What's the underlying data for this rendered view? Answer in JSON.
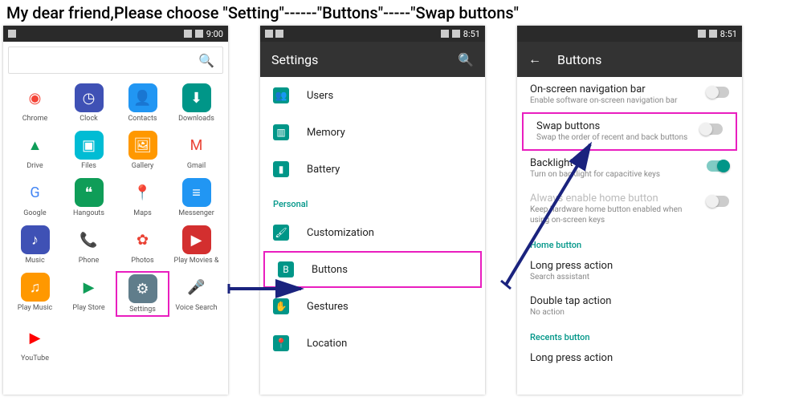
{
  "instruction": "My dear friend,Please choose \"Setting\"------\"Buttons\"-----\"Swap buttons\"",
  "time1": "9:00",
  "time2": "8:51",
  "time3": "8:51",
  "panel1": {
    "apps": [
      {
        "label": "Chrome",
        "bg": "#fff",
        "glyph": "◉",
        "fg": "#f44336"
      },
      {
        "label": "Clock",
        "bg": "#3f51b5",
        "glyph": "◷"
      },
      {
        "label": "Contacts",
        "bg": "#2196f3",
        "glyph": "👤"
      },
      {
        "label": "Downloads",
        "bg": "#009688",
        "glyph": "⬇"
      },
      {
        "label": "Drive",
        "bg": "#fff",
        "glyph": "▲",
        "fg": "#0f9d58"
      },
      {
        "label": "Files",
        "bg": "#00bcd4",
        "glyph": "▣"
      },
      {
        "label": "Gallery",
        "bg": "#ff9800",
        "glyph": "🖼"
      },
      {
        "label": "Gmail",
        "bg": "#fff",
        "glyph": "M",
        "fg": "#ea4335"
      },
      {
        "label": "Google",
        "bg": "#fff",
        "glyph": "G",
        "fg": "#4285f4"
      },
      {
        "label": "Hangouts",
        "bg": "#0f9d58",
        "glyph": "❝"
      },
      {
        "label": "Maps",
        "bg": "#fff",
        "glyph": "📍",
        "fg": "#ea4335"
      },
      {
        "label": "Messenger",
        "bg": "#2196f3",
        "glyph": "≡"
      },
      {
        "label": "Music",
        "bg": "#3f51b5",
        "glyph": "♪"
      },
      {
        "label": "Phone",
        "bg": "#fff",
        "glyph": "📞",
        "fg": "#2196f3"
      },
      {
        "label": "Photos",
        "bg": "#fff",
        "glyph": "✿",
        "fg": "#ea4335"
      },
      {
        "label": "Play Movies &",
        "bg": "#d32f2f",
        "glyph": "▶"
      },
      {
        "label": "Play Music",
        "bg": "#ff9800",
        "glyph": "♫"
      },
      {
        "label": "Play Store",
        "bg": "#fff",
        "glyph": "▶",
        "fg": "#0f9d58"
      },
      {
        "label": "Settings",
        "bg": "#607d8b",
        "glyph": "⚙"
      },
      {
        "label": "Voice Search",
        "bg": "#fff",
        "glyph": "🎤",
        "fg": "#4285f4"
      },
      {
        "label": "YouTube",
        "bg": "#fff",
        "glyph": "▶",
        "fg": "#ff0000"
      }
    ]
  },
  "panel2": {
    "title": "Settings",
    "items_top": [
      {
        "label": "Users",
        "bg": "#009688",
        "glyph": "👥"
      },
      {
        "label": "Memory",
        "bg": "#009688",
        "glyph": "▥"
      },
      {
        "label": "Battery",
        "bg": "#009688",
        "glyph": "▮"
      }
    ],
    "header_personal": "Personal",
    "items_personal": [
      {
        "label": "Customization",
        "bg": "#009688",
        "glyph": "🖌"
      },
      {
        "label": "Buttons",
        "bg": "#009688",
        "glyph": "B"
      },
      {
        "label": "Gestures",
        "bg": "#009688",
        "glyph": "✋"
      },
      {
        "label": "Location",
        "bg": "#009688",
        "glyph": "📍"
      }
    ]
  },
  "panel3": {
    "title": "Buttons",
    "rows": [
      {
        "title": "On-screen navigation bar",
        "sub": "Enable software on-screen navigation bar",
        "switch": "off"
      },
      {
        "title": "Swap buttons",
        "sub": "Swap the order of recent and back buttons",
        "switch": "off",
        "highlight": true
      },
      {
        "title": "Backlight",
        "sub": "Turn on backlight for capacitive keys",
        "switch": "on"
      },
      {
        "title": "Always enable home button",
        "sub": "Keep hardware home button enabled when using on-screen keys",
        "switch": "off",
        "disabled": true
      }
    ],
    "header_home": "Home button",
    "home_rows": [
      {
        "title": "Long press action",
        "sub": "Search assistant"
      },
      {
        "title": "Double tap action",
        "sub": "No action"
      }
    ],
    "header_recents": "Recents button",
    "recents_rows": [
      {
        "title": "Long press action",
        "sub": ""
      }
    ]
  }
}
